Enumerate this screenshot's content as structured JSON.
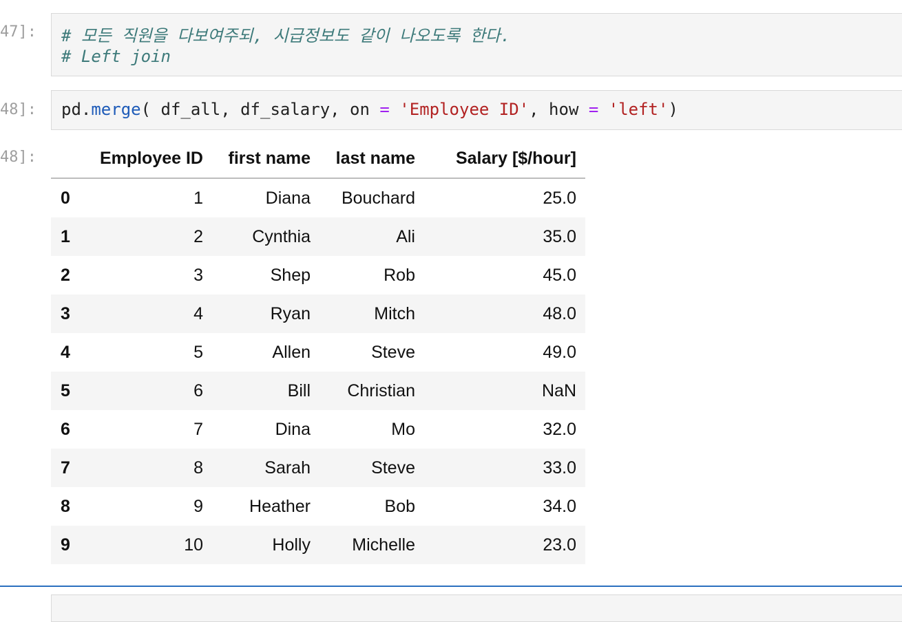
{
  "cells": [
    {
      "prompt": "47]:",
      "lines": [
        {
          "text": "# 모든 직원을 다보여주되, 시급정보도 같이 나오도록 한다."
        },
        {
          "text": "# Left join"
        }
      ]
    },
    {
      "prompt": "48]:",
      "code": {
        "t1": "pd.",
        "t2": "merge",
        "t3": "( df_all, df_salary, on ",
        "t4": "=",
        "t5": " ",
        "t6": "'Employee ID'",
        "t7": ", how ",
        "t8": "=",
        "t9": " ",
        "t10": "'left'",
        "t11": ")"
      }
    }
  ],
  "output": {
    "prompt": "48]:",
    "columns": [
      "",
      "Employee ID",
      "first name",
      "last name",
      "Salary [$/hour]"
    ],
    "rows": [
      [
        "0",
        "1",
        "Diana",
        "Bouchard",
        "25.0"
      ],
      [
        "1",
        "2",
        "Cynthia",
        "Ali",
        "35.0"
      ],
      [
        "2",
        "3",
        "Shep",
        "Rob",
        "45.0"
      ],
      [
        "3",
        "4",
        "Ryan",
        "Mitch",
        "48.0"
      ],
      [
        "4",
        "5",
        "Allen",
        "Steve",
        "49.0"
      ],
      [
        "5",
        "6",
        "Bill",
        "Christian",
        "NaN"
      ],
      [
        "6",
        "7",
        "Dina",
        "Mo",
        "32.0"
      ],
      [
        "7",
        "8",
        "Sarah",
        "Steve",
        "33.0"
      ],
      [
        "8",
        "9",
        "Heather",
        "Bob",
        "34.0"
      ],
      [
        "9",
        "10",
        "Holly",
        "Michelle",
        "23.0"
      ]
    ]
  }
}
